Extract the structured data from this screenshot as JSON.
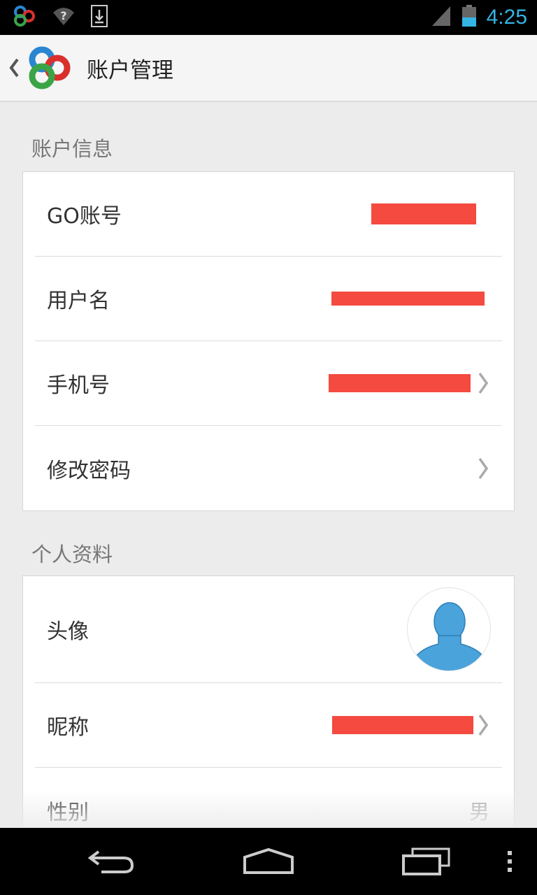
{
  "status_bar": {
    "time": "4:25",
    "icons": [
      "go-launcher-notification-icon",
      "wifi-question-icon",
      "download-icon",
      "signal-icon",
      "battery-icon"
    ]
  },
  "action_bar": {
    "title": "账户管理",
    "back_icon": "chevron-left-icon",
    "logo": "go-launcher-logo"
  },
  "sections": {
    "account_info": {
      "header": "账户信息",
      "rows": [
        {
          "label": "GO账号"
        },
        {
          "label": "用户名"
        },
        {
          "label": "手机号"
        },
        {
          "label": "修改密码"
        }
      ]
    },
    "profile": {
      "header": "个人资料",
      "rows": [
        {
          "label": "头像"
        },
        {
          "label": "昵称"
        },
        {
          "label": "性别",
          "value": "男"
        }
      ]
    }
  },
  "colors": {
    "accent": "#33b5e5",
    "redaction": "#f44a3f",
    "avatar": "#4aa3db"
  },
  "nav_bar": {
    "icons": [
      "back-arrow-icon",
      "home-icon",
      "recent-apps-icon",
      "overflow-menu-icon"
    ]
  }
}
